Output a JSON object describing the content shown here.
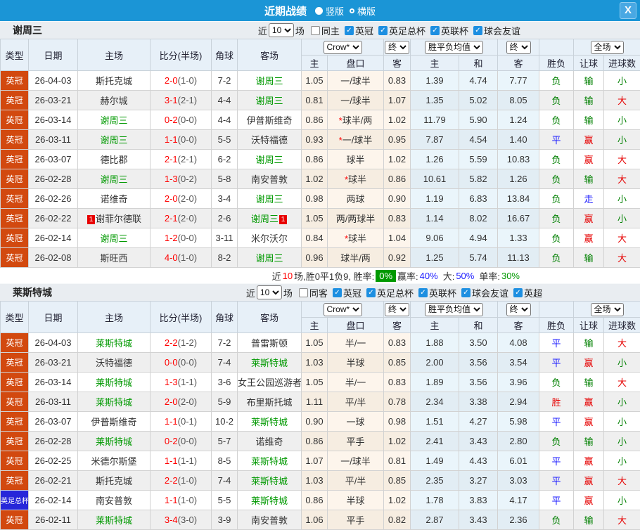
{
  "titlebar": {
    "title": "近期战绩",
    "radio_vertical": "竖版",
    "radio_horizontal": "横版",
    "close": "X"
  },
  "columns": {
    "type": "类型",
    "date": "日期",
    "home": "主场",
    "score": "比分(半场)",
    "corner": "角球",
    "away": "客场",
    "odds_home": "主",
    "handicap": "盘口",
    "odds_away": "客",
    "avg_home": "主",
    "avg_draw": "和",
    "avg_away": "客",
    "result": "胜负",
    "handicap_result": "让球",
    "goals": "进球数"
  },
  "dropdowns": {
    "bookmaker": "Crow*",
    "final1": "终",
    "avg": "胜平负均值",
    "final2": "终",
    "fulltime": "全场"
  },
  "sections": [
    {
      "team": "谢周三",
      "near_label": "近",
      "count": "10",
      "games_label": "场",
      "same_label": "同主",
      "leagues": [
        "英冠",
        "英足总杯",
        "英联杯",
        "球会友谊"
      ],
      "rows": [
        {
          "type": "英冠",
          "type_color": "orange",
          "date": "26-04-03",
          "home": "斯托克城",
          "home_side": "opp",
          "home_card": "",
          "ft": "2-0",
          "ht": "(1-0)",
          "corner": "7-2",
          "away": "谢周三",
          "away_side": "self",
          "away_card": "",
          "o1": "1.05",
          "pk": "一/球半",
          "pk_star": false,
          "o2": "0.83",
          "a1": "1.39",
          "a2": "4.74",
          "a3": "7.77",
          "res": "负",
          "res_c": "green",
          "let": "输",
          "let_c": "green",
          "goal": "小",
          "goal_c": "green"
        },
        {
          "type": "英冠",
          "type_color": "orange",
          "date": "26-03-21",
          "home": "赫尔城",
          "home_side": "opp",
          "home_card": "",
          "ft": "3-1",
          "ht": "(2-1)",
          "corner": "4-4",
          "away": "谢周三",
          "away_side": "self",
          "away_card": "",
          "o1": "0.81",
          "pk": "一/球半",
          "pk_star": false,
          "o2": "1.07",
          "a1": "1.35",
          "a2": "5.02",
          "a3": "8.05",
          "res": "负",
          "res_c": "green",
          "let": "输",
          "let_c": "green",
          "goal": "大",
          "goal_c": "red"
        },
        {
          "type": "英冠",
          "type_color": "orange",
          "date": "26-03-14",
          "home": "谢周三",
          "home_side": "self",
          "home_card": "",
          "ft": "0-2",
          "ht": "(0-0)",
          "corner": "4-4",
          "away": "伊普斯维奇",
          "away_side": "opp",
          "away_card": "",
          "o1": "0.86",
          "pk": "球半/两",
          "pk_star": true,
          "o2": "1.02",
          "a1": "11.79",
          "a2": "5.90",
          "a3": "1.24",
          "res": "负",
          "res_c": "green",
          "let": "输",
          "let_c": "green",
          "goal": "小",
          "goal_c": "green"
        },
        {
          "type": "英冠",
          "type_color": "orange",
          "date": "26-03-11",
          "home": "谢周三",
          "home_side": "self",
          "home_card": "",
          "ft": "1-1",
          "ht": "(0-0)",
          "corner": "5-5",
          "away": "沃特福德",
          "away_side": "opp",
          "away_card": "",
          "o1": "0.93",
          "pk": "一/球半",
          "pk_star": true,
          "o2": "0.95",
          "a1": "7.87",
          "a2": "4.54",
          "a3": "1.40",
          "res": "平",
          "res_c": "blue",
          "let": "赢",
          "let_c": "red",
          "goal": "小",
          "goal_c": "green"
        },
        {
          "type": "英冠",
          "type_color": "orange",
          "date": "26-03-07",
          "home": "德比郡",
          "home_side": "opp",
          "home_card": "",
          "ft": "2-1",
          "ht": "(2-1)",
          "corner": "6-2",
          "away": "谢周三",
          "away_side": "self",
          "away_card": "",
          "o1": "0.86",
          "pk": "球半",
          "pk_star": false,
          "o2": "1.02",
          "a1": "1.26",
          "a2": "5.59",
          "a3": "10.83",
          "res": "负",
          "res_c": "green",
          "let": "赢",
          "let_c": "red",
          "goal": "大",
          "goal_c": "red"
        },
        {
          "type": "英冠",
          "type_color": "orange",
          "date": "26-02-28",
          "home": "谢周三",
          "home_side": "self",
          "home_card": "",
          "ft": "1-3",
          "ht": "(0-2)",
          "corner": "5-8",
          "away": "南安普敦",
          "away_side": "opp",
          "away_card": "",
          "o1": "1.02",
          "pk": "球半",
          "pk_star": true,
          "o2": "0.86",
          "a1": "10.61",
          "a2": "5.82",
          "a3": "1.26",
          "res": "负",
          "res_c": "green",
          "let": "输",
          "let_c": "green",
          "goal": "大",
          "goal_c": "red"
        },
        {
          "type": "英冠",
          "type_color": "orange",
          "date": "26-02-26",
          "home": "诺维奇",
          "home_side": "opp",
          "home_card": "",
          "ft": "2-0",
          "ht": "(2-0)",
          "corner": "3-4",
          "away": "谢周三",
          "away_side": "self",
          "away_card": "",
          "o1": "0.98",
          "pk": "两球",
          "pk_star": false,
          "o2": "0.90",
          "a1": "1.19",
          "a2": "6.83",
          "a3": "13.84",
          "res": "负",
          "res_c": "green",
          "let": "走",
          "let_c": "blue",
          "goal": "小",
          "goal_c": "green"
        },
        {
          "type": "英冠",
          "type_color": "orange",
          "date": "26-02-22",
          "home": "谢菲尔德联",
          "home_side": "opp",
          "home_card": "1",
          "ft": "2-1",
          "ht": "(2-0)",
          "corner": "2-6",
          "away": "谢周三",
          "away_side": "self",
          "away_card": "1",
          "o1": "1.05",
          "pk": "两/两球半",
          "pk_star": false,
          "o2": "0.83",
          "a1": "1.14",
          "a2": "8.02",
          "a3": "16.67",
          "res": "负",
          "res_c": "green",
          "let": "赢",
          "let_c": "red",
          "goal": "小",
          "goal_c": "green"
        },
        {
          "type": "英冠",
          "type_color": "orange",
          "date": "26-02-14",
          "home": "谢周三",
          "home_side": "self",
          "home_card": "",
          "ft": "1-2",
          "ht": "(0-0)",
          "corner": "3-11",
          "away": "米尔沃尔",
          "away_side": "opp",
          "away_card": "",
          "o1": "0.84",
          "pk": "球半",
          "pk_star": true,
          "o2": "1.04",
          "a1": "9.06",
          "a2": "4.94",
          "a3": "1.33",
          "res": "负",
          "res_c": "green",
          "let": "赢",
          "let_c": "red",
          "goal": "大",
          "goal_c": "red"
        },
        {
          "type": "英冠",
          "type_color": "orange",
          "date": "26-02-08",
          "home": "斯旺西",
          "home_side": "opp",
          "home_card": "",
          "ft": "4-0",
          "ht": "(1-0)",
          "corner": "8-2",
          "away": "谢周三",
          "away_side": "self",
          "away_card": "",
          "o1": "0.96",
          "pk": "球半/两",
          "pk_star": false,
          "o2": "0.92",
          "a1": "1.25",
          "a2": "5.74",
          "a3": "11.13",
          "res": "负",
          "res_c": "green",
          "let": "输",
          "let_c": "green",
          "goal": "大",
          "goal_c": "red"
        }
      ],
      "summary": {
        "prefix": "近",
        "count": "10",
        "mid": "场,胜0平1负9, 胜率:",
        "win_badge": "0%",
        "win_rate_label": "赢率:",
        "win_rate": "40%",
        "big_label": "大:",
        "big": "50%",
        "single_label": "单率:",
        "single": "30%"
      }
    },
    {
      "team": "莱斯特城",
      "near_label": "近",
      "count": "10",
      "games_label": "场",
      "same_label": "同客",
      "leagues": [
        "英冠",
        "英足总杯",
        "英联杯",
        "球会友谊",
        "英超"
      ],
      "rows": [
        {
          "type": "英冠",
          "type_color": "orange",
          "date": "26-04-03",
          "home": "莱斯特城",
          "home_side": "self",
          "home_card": "",
          "ft": "2-2",
          "ht": "(1-2)",
          "corner": "7-2",
          "away": "普雷斯顿",
          "away_side": "opp",
          "away_card": "",
          "o1": "1.05",
          "pk": "半/一",
          "pk_star": false,
          "o2": "0.83",
          "a1": "1.88",
          "a2": "3.50",
          "a3": "4.08",
          "res": "平",
          "res_c": "blue",
          "let": "输",
          "let_c": "green",
          "goal": "大",
          "goal_c": "red"
        },
        {
          "type": "英冠",
          "type_color": "orange",
          "date": "26-03-21",
          "home": "沃特福德",
          "home_side": "opp",
          "home_card": "",
          "ft": "0-0",
          "ht": "(0-0)",
          "corner": "7-4",
          "away": "莱斯特城",
          "away_side": "self",
          "away_card": "",
          "o1": "1.03",
          "pk": "半球",
          "pk_star": false,
          "o2": "0.85",
          "a1": "2.00",
          "a2": "3.56",
          "a3": "3.54",
          "res": "平",
          "res_c": "blue",
          "let": "赢",
          "let_c": "red",
          "goal": "小",
          "goal_c": "green"
        },
        {
          "type": "英冠",
          "type_color": "orange",
          "date": "26-03-14",
          "home": "莱斯特城",
          "home_side": "self",
          "home_card": "",
          "ft": "1-3",
          "ht": "(1-1)",
          "corner": "3-6",
          "away": "女王公园巡游者",
          "away_side": "opp",
          "away_card": "",
          "o1": "1.05",
          "pk": "半/一",
          "pk_star": false,
          "o2": "0.83",
          "a1": "1.89",
          "a2": "3.56",
          "a3": "3.96",
          "res": "负",
          "res_c": "green",
          "let": "输",
          "let_c": "green",
          "goal": "大",
          "goal_c": "red"
        },
        {
          "type": "英冠",
          "type_color": "orange",
          "date": "26-03-11",
          "home": "莱斯特城",
          "home_side": "self",
          "home_card": "",
          "ft": "2-0",
          "ht": "(2-0)",
          "corner": "5-9",
          "away": "布里斯托城",
          "away_side": "opp",
          "away_card": "",
          "o1": "1.11",
          "pk": "平/半",
          "pk_star": false,
          "o2": "0.78",
          "a1": "2.34",
          "a2": "3.38",
          "a3": "2.94",
          "res": "胜",
          "res_c": "red",
          "let": "赢",
          "let_c": "red",
          "goal": "小",
          "goal_c": "green"
        },
        {
          "type": "英冠",
          "type_color": "orange",
          "date": "26-03-07",
          "home": "伊普斯维奇",
          "home_side": "opp",
          "home_card": "",
          "ft": "1-1",
          "ht": "(0-1)",
          "corner": "10-2",
          "away": "莱斯特城",
          "away_side": "self",
          "away_card": "",
          "o1": "0.90",
          "pk": "一球",
          "pk_star": false,
          "o2": "0.98",
          "a1": "1.51",
          "a2": "4.27",
          "a3": "5.98",
          "res": "平",
          "res_c": "blue",
          "let": "赢",
          "let_c": "red",
          "goal": "小",
          "goal_c": "green"
        },
        {
          "type": "英冠",
          "type_color": "orange",
          "date": "26-02-28",
          "home": "莱斯特城",
          "home_side": "self",
          "home_card": "",
          "ft": "0-2",
          "ht": "(0-0)",
          "corner": "5-7",
          "away": "诺维奇",
          "away_side": "opp",
          "away_card": "",
          "o1": "0.86",
          "pk": "平手",
          "pk_star": false,
          "o2": "1.02",
          "a1": "2.41",
          "a2": "3.43",
          "a3": "2.80",
          "res": "负",
          "res_c": "green",
          "let": "输",
          "let_c": "green",
          "goal": "小",
          "goal_c": "green"
        },
        {
          "type": "英冠",
          "type_color": "orange",
          "date": "26-02-25",
          "home": "米德尔斯堡",
          "home_side": "opp",
          "home_card": "",
          "ft": "1-1",
          "ht": "(1-1)",
          "corner": "8-5",
          "away": "莱斯特城",
          "away_side": "self",
          "away_card": "",
          "o1": "1.07",
          "pk": "一/球半",
          "pk_star": false,
          "o2": "0.81",
          "a1": "1.49",
          "a2": "4.43",
          "a3": "6.01",
          "res": "平",
          "res_c": "blue",
          "let": "赢",
          "let_c": "red",
          "goal": "小",
          "goal_c": "green"
        },
        {
          "type": "英冠",
          "type_color": "orange",
          "date": "26-02-21",
          "home": "斯托克城",
          "home_side": "opp",
          "home_card": "",
          "ft": "2-2",
          "ht": "(1-0)",
          "corner": "7-4",
          "away": "莱斯特城",
          "away_side": "self",
          "away_card": "",
          "o1": "1.03",
          "pk": "平/半",
          "pk_star": false,
          "o2": "0.85",
          "a1": "2.35",
          "a2": "3.27",
          "a3": "3.03",
          "res": "平",
          "res_c": "blue",
          "let": "赢",
          "let_c": "red",
          "goal": "大",
          "goal_c": "red"
        },
        {
          "type": "英足总杯",
          "type_color": "blue",
          "date": "26-02-14",
          "home": "南安普敦",
          "home_side": "opp",
          "home_card": "",
          "ft": "1-1",
          "ht": "(1-0)",
          "corner": "5-5",
          "away": "莱斯特城",
          "away_side": "self",
          "away_card": "",
          "o1": "0.86",
          "pk": "半球",
          "pk_star": false,
          "o2": "1.02",
          "a1": "1.78",
          "a2": "3.83",
          "a3": "4.17",
          "res": "平",
          "res_c": "blue",
          "let": "赢",
          "let_c": "red",
          "goal": "小",
          "goal_c": "green"
        },
        {
          "type": "英冠",
          "type_color": "orange",
          "date": "26-02-11",
          "home": "莱斯特城",
          "home_side": "self",
          "home_card": "",
          "ft": "3-4",
          "ht": "(3-0)",
          "corner": "3-9",
          "away": "南安普敦",
          "away_side": "opp",
          "away_card": "",
          "o1": "1.06",
          "pk": "平手",
          "pk_star": false,
          "o2": "0.82",
          "a1": "2.87",
          "a2": "3.43",
          "a3": "2.36",
          "res": "负",
          "res_c": "green",
          "let": "输",
          "let_c": "green",
          "goal": "大",
          "goal_c": "red"
        }
      ]
    }
  ]
}
